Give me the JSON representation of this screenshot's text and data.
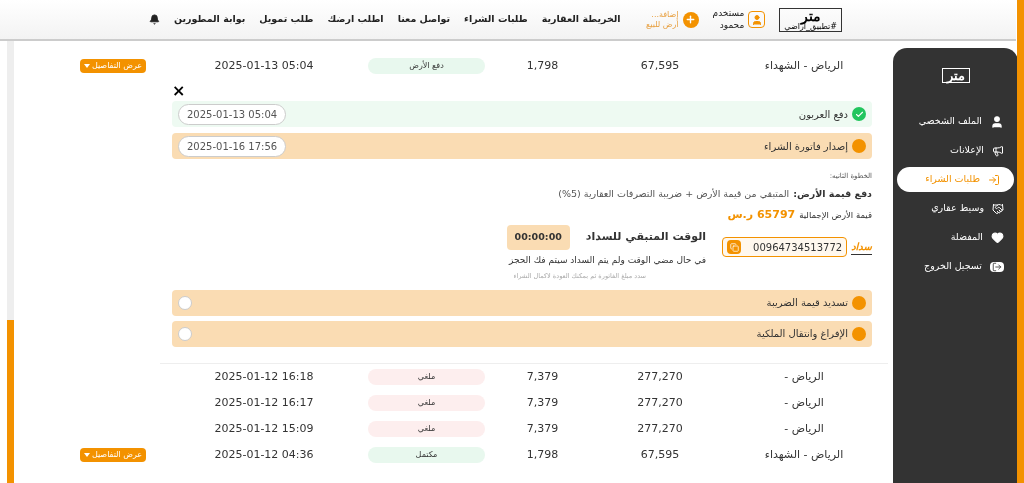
{
  "header": {
    "logo": {
      "name": "متر",
      "tagline": "#تطبيق_أراضي"
    },
    "user": {
      "role": "مستخدم",
      "name": "محمود"
    },
    "add_land": {
      "label": "إضافة... أرض للبيع"
    },
    "nav": [
      "الخريطة العقارية",
      "طلبات الشراء",
      "تواصل معنا",
      "اطلب ارضك",
      "طلب تمويل",
      "بوابة المطورين"
    ]
  },
  "sidebar": {
    "logo": "متر",
    "items": [
      {
        "label": "الملف الشخصي",
        "kind": "user",
        "selected": false
      },
      {
        "label": "الإعلانات",
        "kind": "megaphone",
        "selected": false
      },
      {
        "label": "طلبات الشراء",
        "kind": "login",
        "selected": true
      },
      {
        "label": "وسيط عقاري",
        "kind": "handshake",
        "selected": false
      },
      {
        "label": "المفضلة",
        "kind": "heart",
        "selected": false
      },
      {
        "label": "تسجيل الخروج",
        "kind": "logout",
        "selected": false
      }
    ]
  },
  "top_rows": [
    {
      "location": "الرياض - الشهداء",
      "price": "67,595",
      "area": "1,798",
      "status": "دفع الأرض",
      "color": "#e8f8ee",
      "date": "2025-01-13 05:04",
      "details": "عرض التفاصيل"
    }
  ],
  "expansion": {
    "close": "×",
    "steps_before": [
      {
        "label": "دفع العربون",
        "kind": "done",
        "date": "2025-01-13 05:04"
      },
      {
        "label": "إصدار فاتورة الشراء",
        "kind": "current",
        "date": "2025-01-16 17:56"
      }
    ],
    "payment": {
      "step_label": "الخطوة الثانيه:",
      "title": "دفع قيمة الأرض:",
      "description": "المتبقي من قيمة الأرض + ضريبة التصرفات العقارية (5%)",
      "total_label": "قيمة الأرض الإجمالية",
      "total": "65797 ر.س",
      "remaining_label": "الوقت المتبقي للسداد",
      "timer": "00:00:00",
      "warning": "في حال مضي الوقت ولم يتم السداد سيتم فك الحجز",
      "note": "سدد مبلغ الفاتورة ثم بمكنك العودة لاكمال الشراء",
      "sadad": "سداد",
      "bill_number": "00964734513772"
    },
    "steps_after": [
      {
        "label": "تسديد قيمة الضريبة",
        "kind": "pending"
      },
      {
        "label": "الإفراغ وانتقال الملكية",
        "kind": "pending"
      }
    ]
  },
  "rows": [
    {
      "location": "الرياض -",
      "price": "277,270",
      "area": "7,379",
      "status": "ملغي",
      "color": "#fdeeee",
      "date": "2025-01-12 16:18"
    },
    {
      "location": "الرياض -",
      "price": "277,270",
      "area": "7,379",
      "status": "ملغي",
      "color": "#fdeeee",
      "date": "2025-01-12 16:17"
    },
    {
      "location": "الرياض -",
      "price": "277,270",
      "area": "7,379",
      "status": "ملغي",
      "color": "#fdeeee",
      "date": "2025-01-12 15:09"
    },
    {
      "location": "الرياض - الشهداء",
      "price": "67,595",
      "area": "1,798",
      "status": "مكتمل",
      "color": "#e8f8ee",
      "date": "2025-01-12 04:36",
      "details": "عرض التفاصيل"
    }
  ]
}
